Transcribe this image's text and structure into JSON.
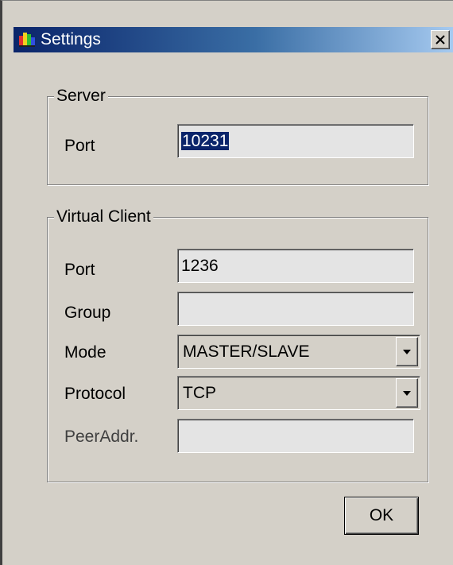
{
  "window": {
    "title": "Settings",
    "close_glyph": "✕",
    "icon": "app-icon"
  },
  "server": {
    "legend": "Server",
    "port_label": "Port",
    "port_value": "10231"
  },
  "virtual_client": {
    "legend": "Virtual Client",
    "port_label": "Port",
    "port_value": "1236",
    "group_label": "Group",
    "group_value": "",
    "mode_label": "Mode",
    "mode_value": "MASTER/SLAVE",
    "protocol_label": "Protocol",
    "protocol_value": "TCP",
    "peeraddr_label": "PeerAddr.",
    "peeraddr_value": ""
  },
  "buttons": {
    "ok_label": "OK"
  },
  "colors": {
    "face": "#d4d0c8",
    "title_start": "#0a246a",
    "title_end": "#a6caf0",
    "selection": "#0a246a"
  }
}
